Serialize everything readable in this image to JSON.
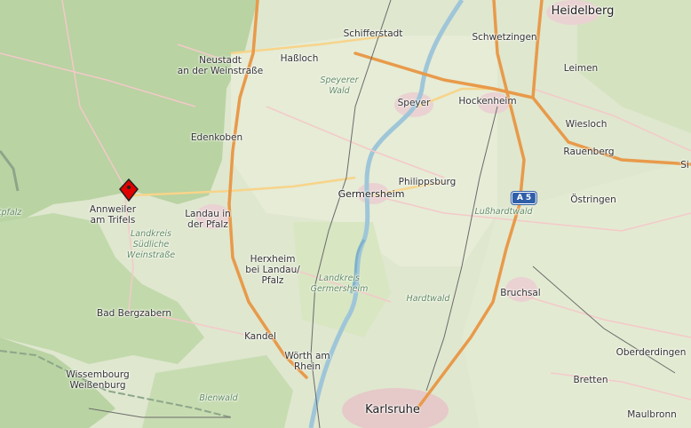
{
  "map": {
    "labels": {
      "heidelberg": "Heidelberg",
      "schifferstadt": "Schifferstadt",
      "schwetzingen": "Schwetzingen",
      "neustadt": "Neustadt\nan der Weinstraße",
      "hassloch": "Haßloch",
      "leimen": "Leimen",
      "speyerer_wald": "Speyerer\nWald",
      "speyer": "Speyer",
      "hockenheim": "Hockenheim",
      "wiesloch": "Wiesloch",
      "edenkoben": "Edenkoben",
      "rauenberg": "Rauenberg",
      "annweiler": "Annweiler\nam Trifels",
      "pfalz_edge": "tpfalz",
      "landau": "Landau in\nder Pfalz",
      "germersheim": "Germersheim",
      "philippsburg": "Philippsburg",
      "lusshardtwald": "Lußhardtwald",
      "ostringen": "Östringen",
      "landkreis_suedl": "Landkreis\nSüdliche\nWeinstraße",
      "herxheim": "Herxheim\nbei Landau/\nPfalz",
      "landkreis_germ": "Landkreis\nGermersheim",
      "hardtwald": "Hardtwald",
      "bruchsal": "Bruchsal",
      "bad_bergzabern": "Bad Bergzabern",
      "kandel": "Kandel",
      "oberderdingen": "Oberderdingen",
      "woerth": "Wörth am\nRhein",
      "wissembourg": "Wissembourg\nWeißenburg",
      "bretten": "Bretten",
      "bienwald": "Bienwald",
      "karlsruhe": "Karlsruhe",
      "maulbronn": "Maulbronn",
      "sinsheim_edge": "Si"
    },
    "shield": "A 5",
    "marker_name": "location-marker"
  }
}
